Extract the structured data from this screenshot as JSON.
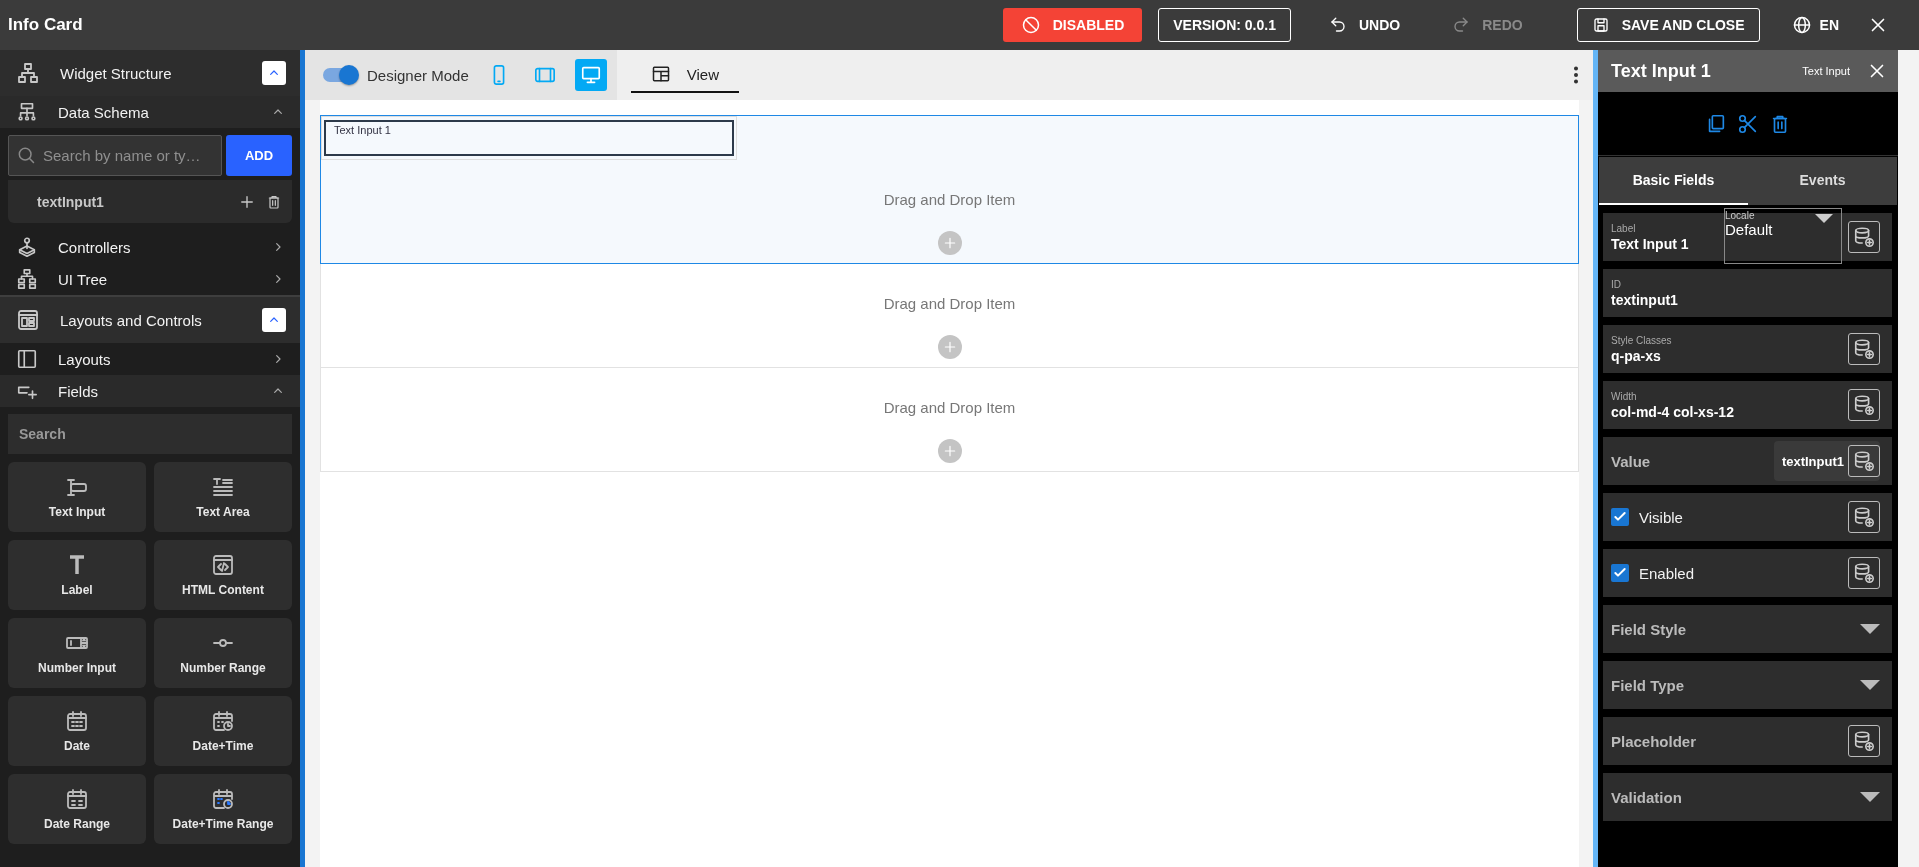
{
  "app_bar": {
    "title": "Info Card",
    "status_button": "DISABLED",
    "version_button": "VERSION: 0.0.1",
    "actions": [
      {
        "label": "UNDO",
        "disabled": false
      },
      {
        "label": "REDO",
        "disabled": true
      }
    ],
    "save_button": "SAVE AND CLOSE",
    "language": "EN"
  },
  "sidebar": {
    "sections": [
      {
        "kind": "group",
        "title": "Widget Structure",
        "expanded": true
      },
      {
        "kind": "nav",
        "title": "Data Schema",
        "expanded": true,
        "search": {
          "placeholder": "Search by name or ty…"
        },
        "add_button": "ADD",
        "items": [
          {
            "name": "textInput1"
          }
        ]
      },
      {
        "kind": "nav",
        "title": "Controllers",
        "expanded": false
      },
      {
        "kind": "nav",
        "title": "UI Tree",
        "expanded": false
      },
      {
        "kind": "group",
        "title": "Layouts and Controls",
        "expanded": true
      },
      {
        "kind": "nav",
        "title": "Layouts",
        "expanded": false
      },
      {
        "kind": "nav",
        "title": "Fields",
        "expanded": true,
        "search": {
          "placeholder": "Search"
        },
        "widgets": [
          {
            "label": "Text Input"
          },
          {
            "label": "Text Area"
          },
          {
            "label": "Label"
          },
          {
            "label": "HTML Content"
          },
          {
            "label": "Number Input"
          },
          {
            "label": "Number Range"
          },
          {
            "label": "Date"
          },
          {
            "label": "Date+Time"
          },
          {
            "label": "Date Range"
          },
          {
            "label": "Date+Time Range"
          }
        ]
      }
    ]
  },
  "designer": {
    "mode_toggle": {
      "label": "Designer Mode",
      "on": true
    },
    "devices": [
      {
        "kind": "phone",
        "selected": false
      },
      {
        "kind": "tablet",
        "selected": false
      },
      {
        "kind": "desktop",
        "selected": true
      }
    ],
    "tabs": [
      {
        "label": "View",
        "selected": true
      }
    ],
    "drop_zones": [
      {
        "text": "Drag and Drop Item",
        "selected": true,
        "widgets": [
          {
            "label": "Text Input 1"
          }
        ]
      },
      {
        "text": "Drag and Drop Item",
        "selected": false
      },
      {
        "text": "Drag and Drop Item",
        "selected": false
      }
    ]
  },
  "properties": {
    "title": "Text Input 1",
    "type": "Text Input",
    "tabs": [
      {
        "label": "Basic Fields",
        "selected": true
      },
      {
        "label": "Events",
        "selected": false
      }
    ],
    "rows": [
      {
        "kind": "text",
        "label": "Label",
        "value": "Text Input 1",
        "locale": {
          "label": "Locale",
          "value": "Default"
        },
        "binding": true
      },
      {
        "kind": "text",
        "label": "ID",
        "value": "textinput1",
        "binding": false
      },
      {
        "kind": "text",
        "label": "Style Classes",
        "value": "q-pa-xs",
        "binding": true
      },
      {
        "kind": "text",
        "label": "Width",
        "value": "col-md-4 col-xs-12",
        "binding": true
      },
      {
        "kind": "bound",
        "label": "Value",
        "value": "textInput1",
        "binding": true
      },
      {
        "kind": "checkbox",
        "label": "Visible",
        "checked": true,
        "binding": true
      },
      {
        "kind": "checkbox",
        "label": "Enabled",
        "checked": true,
        "binding": true
      },
      {
        "kind": "dropdown",
        "label": "Field Style",
        "binding": false
      },
      {
        "kind": "dropdown",
        "label": "Field Type",
        "binding": false
      },
      {
        "kind": "plain",
        "label": "Placeholder",
        "binding": true
      },
      {
        "kind": "dropdown",
        "label": "Validation",
        "binding": false
      }
    ]
  }
}
